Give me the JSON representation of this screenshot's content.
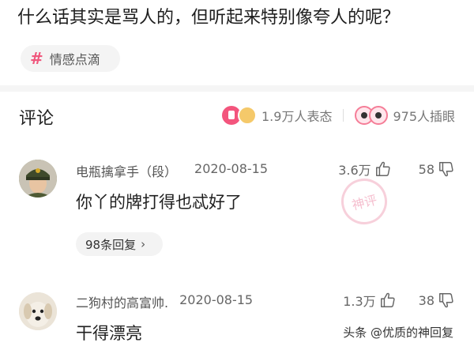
{
  "question": {
    "title": "什么话其实是骂人的，但听起来特别像夸人的呢？"
  },
  "tag": {
    "hash": "#",
    "label": "情感点滴"
  },
  "comments_header": {
    "title": "评论",
    "reactions_text": "1.9万人表态",
    "views_text": "975人插眼"
  },
  "comments": [
    {
      "author": "电瓶擒拿手（段）",
      "date": "2020-08-15",
      "likes": "3.6万",
      "dislikes": "58",
      "text": "你丫的牌打得也忒好了",
      "reply_label": "98条回复",
      "reply_chevron": "›",
      "stamp": "神评"
    },
    {
      "author": "二狗村的高富帅.",
      "date": "2020-08-15",
      "likes": "1.3万",
      "dislikes": "38",
      "text": "干得漂亮"
    }
  ],
  "watermark": "头条 @优质的神回复",
  "icons": {
    "tag": "hash-icon",
    "reaction_like": "like-emoji-icon",
    "reaction_hand": "hand-emoji-icon",
    "views": "eyes-emoji-icon",
    "thumbs_up": "thumbs-up-icon",
    "thumbs_down": "thumbs-down-icon"
  },
  "colors": {
    "accent": "#f0587d",
    "muted": "#777777"
  }
}
